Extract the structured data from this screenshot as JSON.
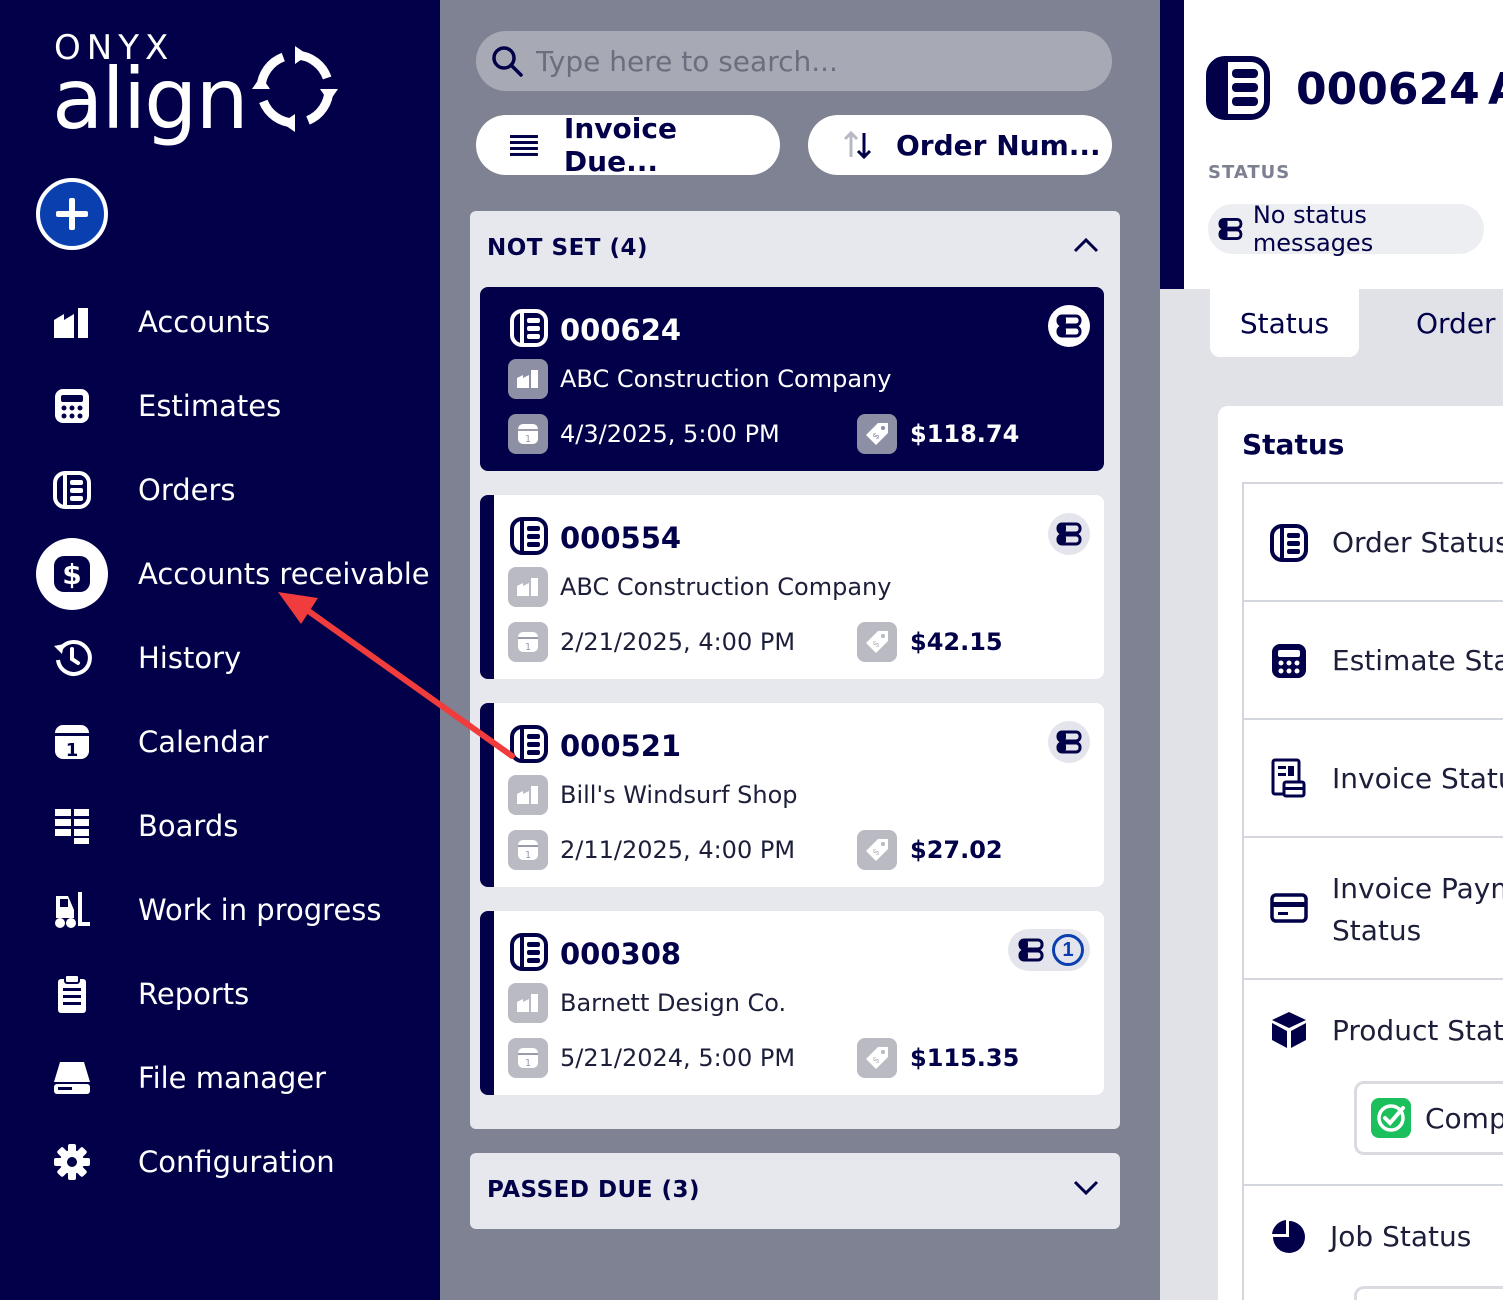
{
  "brand": {
    "top": "ONYX",
    "bottom": "align"
  },
  "sidebar": {
    "items": [
      {
        "label": "Accounts",
        "icon": "accounts-icon"
      },
      {
        "label": "Estimates",
        "icon": "calculator-icon"
      },
      {
        "label": "Orders",
        "icon": "orders-icon"
      },
      {
        "label": "Accounts receivable",
        "icon": "dollar-icon"
      },
      {
        "label": "History",
        "icon": "history-icon"
      },
      {
        "label": "Calendar",
        "icon": "calendar-icon"
      },
      {
        "label": "Boards",
        "icon": "boards-icon"
      },
      {
        "label": "Work in progress",
        "icon": "forklift-icon"
      },
      {
        "label": "Reports",
        "icon": "clipboard-icon"
      },
      {
        "label": "File manager",
        "icon": "drive-icon"
      },
      {
        "label": "Configuration",
        "icon": "gear-icon"
      }
    ]
  },
  "search": {
    "placeholder": "Type here to search..."
  },
  "filters": {
    "sort1": "Invoice Due...",
    "sort2": "Order Num..."
  },
  "groups": [
    {
      "label": "NOT SET (4)"
    },
    {
      "label": "PASSED DUE (3)"
    }
  ],
  "cards": [
    {
      "number": "000624",
      "company": "ABC Construction Company",
      "date": "4/3/2025, 5:00 PM",
      "amount": "$118.74"
    },
    {
      "number": "000554",
      "company": "ABC Construction Company",
      "date": "2/21/2025, 4:00 PM",
      "amount": "$42.15"
    },
    {
      "number": "000521",
      "company": "Bill's Windsurf Shop",
      "date": "2/11/2025, 4:00 PM",
      "amount": "$27.02"
    },
    {
      "number": "000308",
      "company": "Barnett Design Co.",
      "date": "5/21/2024, 5:00 PM",
      "amount": "$115.35",
      "badge": "1"
    }
  ],
  "detail": {
    "number": "000624",
    "number_suffix": "A",
    "status_label": "STATUS",
    "status_message": "No status messages",
    "tabs": [
      "Status",
      "Order"
    ],
    "panel_title": "Status",
    "rows": [
      "Order Status",
      "Estimate Stat",
      "Invoice Statu",
      "Invoice Paym",
      "Status",
      "Product Statu",
      "Job Status"
    ],
    "complete_chip": "Comp"
  },
  "colors": {
    "navy": "#010048",
    "accent": "#0a3fb0",
    "arrow": "#f03c3c",
    "success": "#1bbf5c"
  }
}
